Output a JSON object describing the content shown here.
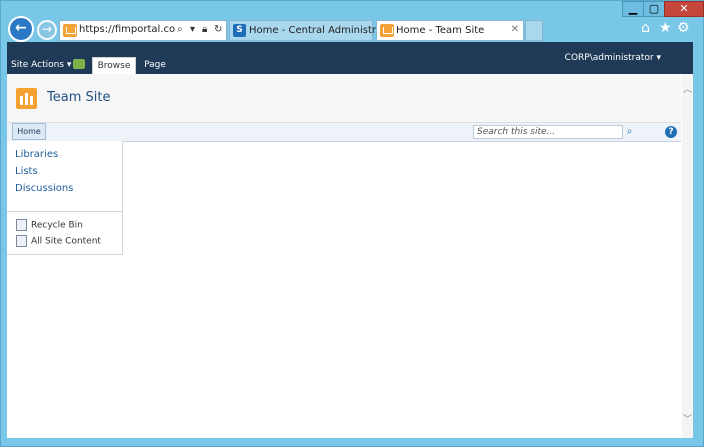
{
  "browser": {
    "address": "https://fimportal.corp.c...",
    "tabs": [
      {
        "label": "Home - Central Administration",
        "active": false
      },
      {
        "label": "Home - Team Site",
        "active": true
      }
    ]
  },
  "ribbon": {
    "site_actions": "Site Actions ▾",
    "tabs": [
      "Browse",
      "Page"
    ],
    "user": "CORP\\administrator ▾"
  },
  "site": {
    "title": "Team Site"
  },
  "topnav": {
    "home": "Home",
    "search_placeholder": "Search this site..."
  },
  "leftnav": {
    "links": [
      "Libraries",
      "Lists",
      "Discussions"
    ],
    "utility": [
      "Recycle Bin",
      "All Site Content"
    ]
  },
  "colors": {
    "ribbon_bg": "#1f3a57",
    "frame": "#79c7e8",
    "link": "#1f5e9a"
  }
}
